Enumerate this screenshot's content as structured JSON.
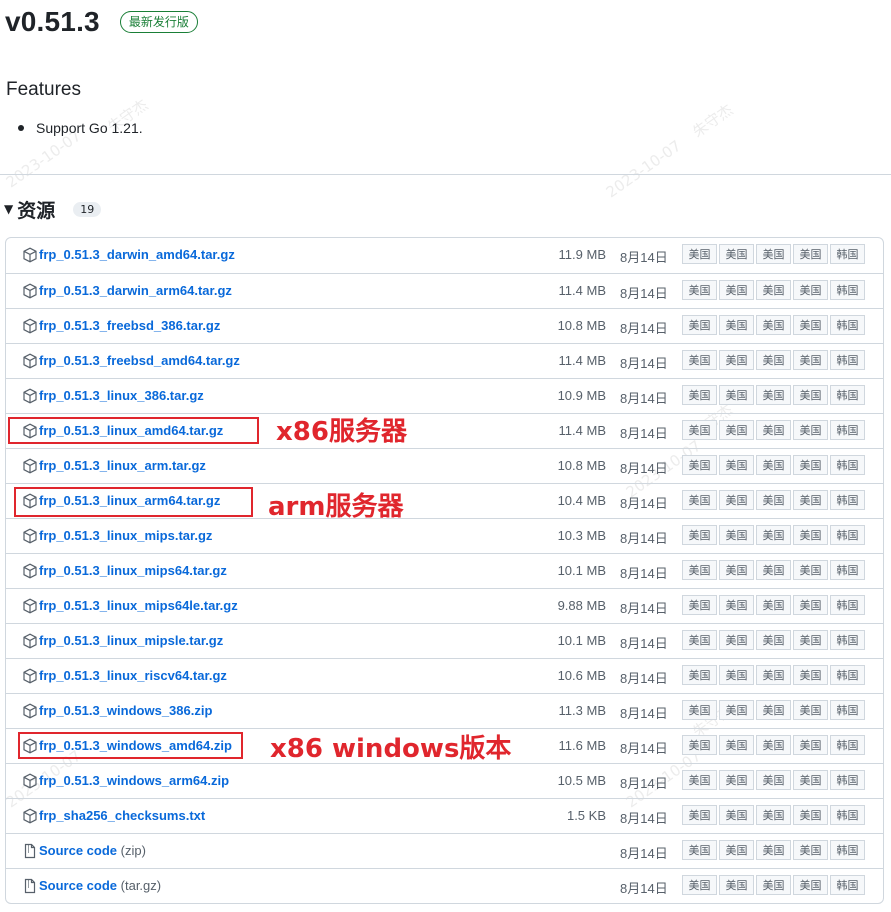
{
  "release": {
    "version": "v0.51.3",
    "badge": "最新发行版"
  },
  "features": {
    "title": "Features",
    "items": [
      "Support Go 1.21."
    ]
  },
  "assets": {
    "title": "资源",
    "count": "19",
    "items": [
      {
        "name": "frp_0.51.3_darwin_amd64.tar.gz",
        "suffix": "",
        "size": "11.9 MB",
        "date": "8月14日",
        "icon": "package-icon"
      },
      {
        "name": "frp_0.51.3_darwin_arm64.tar.gz",
        "suffix": "",
        "size": "11.4 MB",
        "date": "8月14日",
        "icon": "package-icon"
      },
      {
        "name": "frp_0.51.3_freebsd_386.tar.gz",
        "suffix": "",
        "size": "10.8 MB",
        "date": "8月14日",
        "icon": "package-icon"
      },
      {
        "name": "frp_0.51.3_freebsd_amd64.tar.gz",
        "suffix": "",
        "size": "11.4 MB",
        "date": "8月14日",
        "icon": "package-icon"
      },
      {
        "name": "frp_0.51.3_linux_386.tar.gz",
        "suffix": "",
        "size": "10.9 MB",
        "date": "8月14日",
        "icon": "package-icon"
      },
      {
        "name": "frp_0.51.3_linux_amd64.tar.gz",
        "suffix": "",
        "size": "11.4 MB",
        "date": "8月14日",
        "icon": "package-icon"
      },
      {
        "name": "frp_0.51.3_linux_arm.tar.gz",
        "suffix": "",
        "size": "10.8 MB",
        "date": "8月14日",
        "icon": "package-icon"
      },
      {
        "name": "frp_0.51.3_linux_arm64.tar.gz",
        "suffix": "",
        "size": "10.4 MB",
        "date": "8月14日",
        "icon": "package-icon"
      },
      {
        "name": "frp_0.51.3_linux_mips.tar.gz",
        "suffix": "",
        "size": "10.3 MB",
        "date": "8月14日",
        "icon": "package-icon"
      },
      {
        "name": "frp_0.51.3_linux_mips64.tar.gz",
        "suffix": "",
        "size": "10.1 MB",
        "date": "8月14日",
        "icon": "package-icon"
      },
      {
        "name": "frp_0.51.3_linux_mips64le.tar.gz",
        "suffix": "",
        "size": "9.88 MB",
        "date": "8月14日",
        "icon": "package-icon"
      },
      {
        "name": "frp_0.51.3_linux_mipsle.tar.gz",
        "suffix": "",
        "size": "10.1 MB",
        "date": "8月14日",
        "icon": "package-icon"
      },
      {
        "name": "frp_0.51.3_linux_riscv64.tar.gz",
        "suffix": "",
        "size": "10.6 MB",
        "date": "8月14日",
        "icon": "package-icon"
      },
      {
        "name": "frp_0.51.3_windows_386.zip",
        "suffix": "",
        "size": "11.3 MB",
        "date": "8月14日",
        "icon": "package-icon"
      },
      {
        "name": "frp_0.51.3_windows_amd64.zip",
        "suffix": "",
        "size": "11.6 MB",
        "date": "8月14日",
        "icon": "package-icon"
      },
      {
        "name": "frp_0.51.3_windows_arm64.zip",
        "suffix": "",
        "size": "10.5 MB",
        "date": "8月14日",
        "icon": "package-icon"
      },
      {
        "name": "frp_sha256_checksums.txt",
        "suffix": "",
        "size": "1.5 KB",
        "date": "8月14日",
        "icon": "package-icon"
      },
      {
        "name": "Source code",
        "suffix": " (zip)",
        "size": "",
        "date": "8月14日",
        "icon": "file-zip-icon"
      },
      {
        "name": "Source code",
        "suffix": " (tar.gz)",
        "size": "",
        "date": "8月14日",
        "icon": "file-zip-icon"
      }
    ],
    "mirrors": [
      "美国",
      "美国",
      "美国",
      "美国",
      "韩国"
    ]
  },
  "annotations": {
    "x86_server": "x86服务器",
    "arm_server": "arm服务器",
    "x86_windows": "x86 windows版本"
  },
  "watermark": {
    "date": "2023-10-07",
    "author": "朱守杰"
  },
  "colors": {
    "link": "#0969da",
    "badge_green": "#1a7f37",
    "annotation_red": "#e0262d"
  }
}
